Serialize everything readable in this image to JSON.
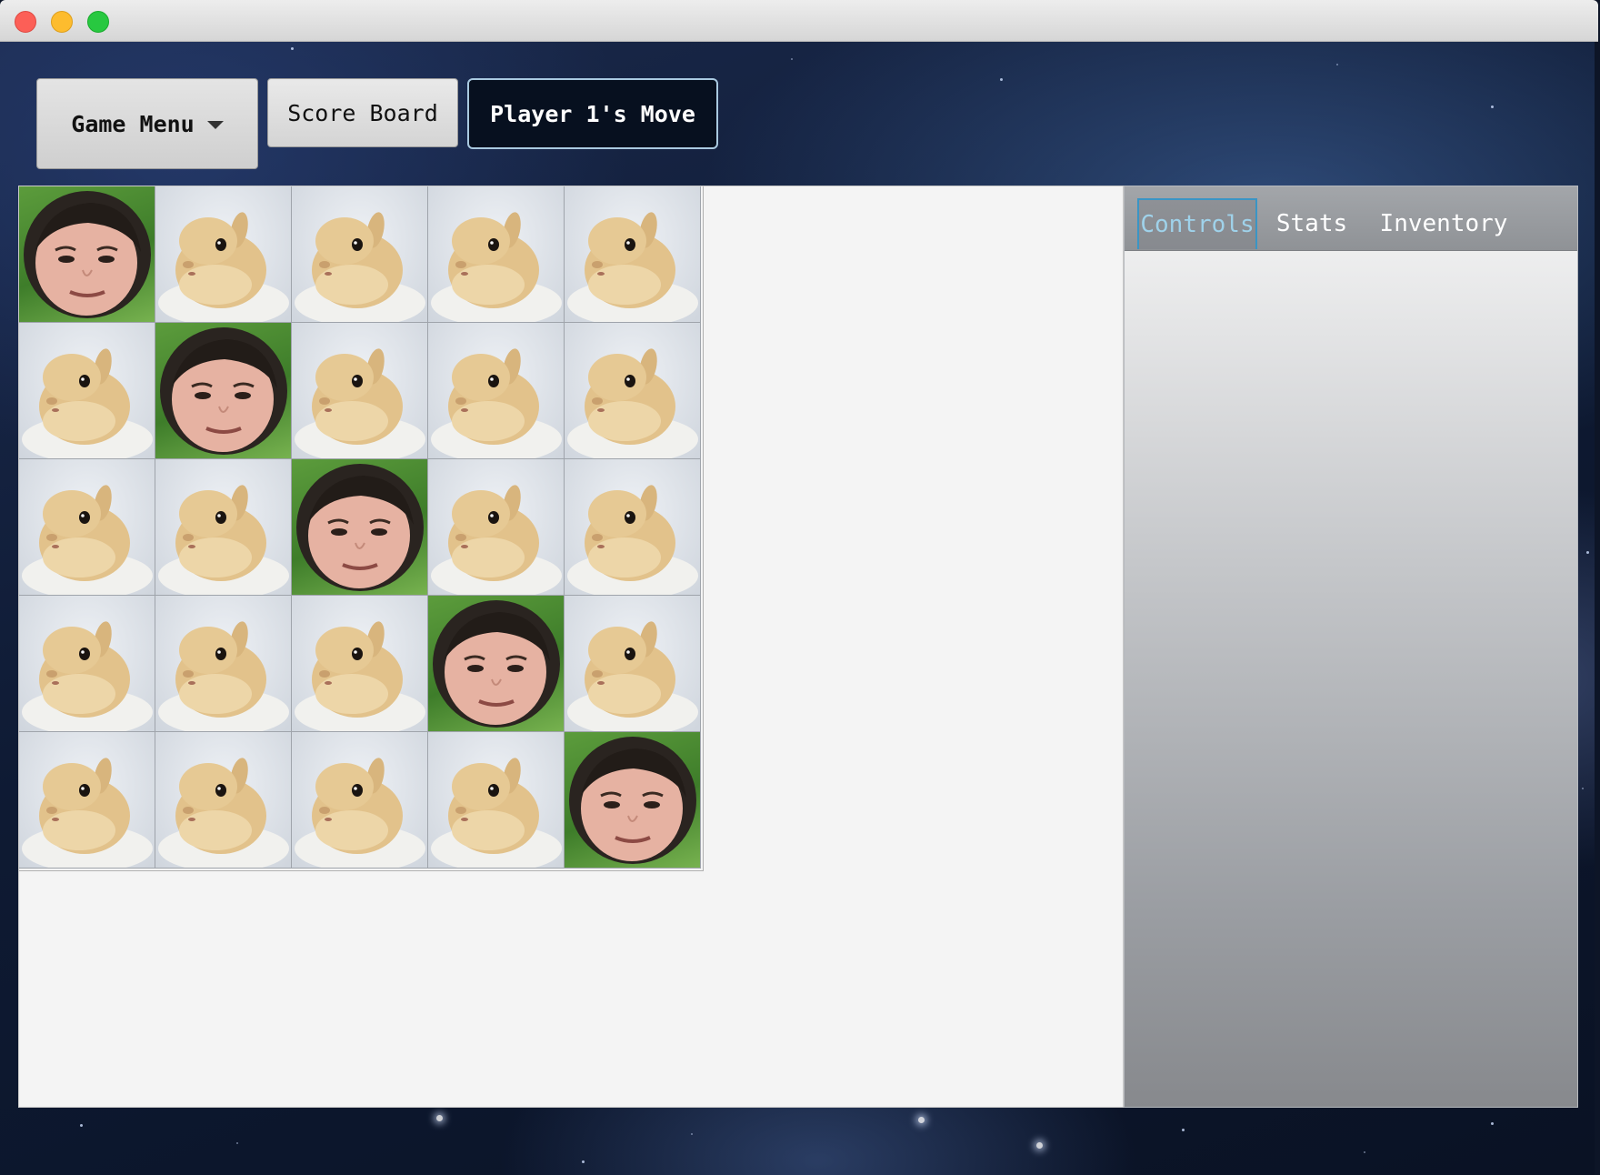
{
  "window": {
    "traffic_lights": [
      "close",
      "minimize",
      "maximize"
    ]
  },
  "toolbar": {
    "game_menu_label": "Game Menu",
    "score_board_label": "Score Board",
    "turn_label": "Player 1's Move"
  },
  "board": {
    "rows": 5,
    "cols": 5,
    "tiles": [
      [
        "face",
        "bunny",
        "bunny",
        "bunny",
        "bunny"
      ],
      [
        "bunny",
        "face",
        "bunny",
        "bunny",
        "bunny"
      ],
      [
        "bunny",
        "bunny",
        "face",
        "bunny",
        "bunny"
      ],
      [
        "bunny",
        "bunny",
        "bunny",
        "face",
        "bunny"
      ],
      [
        "bunny",
        "bunny",
        "bunny",
        "bunny",
        "face"
      ]
    ]
  },
  "side_panel": {
    "tabs": [
      {
        "label": "Controls",
        "active": true
      },
      {
        "label": "Stats",
        "active": false
      },
      {
        "label": "Inventory",
        "active": false
      }
    ]
  },
  "colors": {
    "active_tab_text": "#9fd2ea",
    "active_tab_border": "#3a95c5",
    "turn_button_border": "#a9c9e0"
  }
}
